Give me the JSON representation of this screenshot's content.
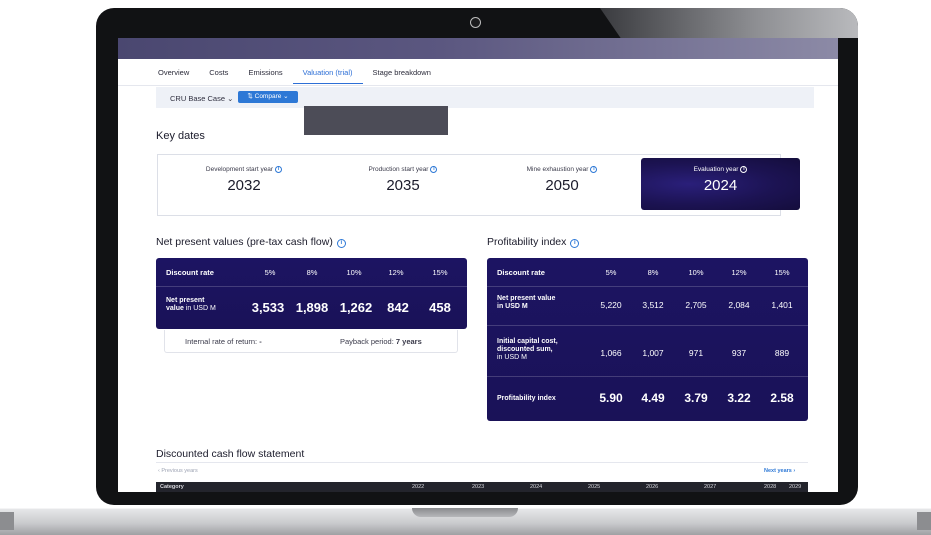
{
  "tabs": [
    {
      "label": "Overview"
    },
    {
      "label": "Costs"
    },
    {
      "label": "Emissions"
    },
    {
      "label": "Valuation (trial)",
      "active": true
    },
    {
      "label": "Stage breakdown"
    }
  ],
  "scenario": {
    "selected": "CRU Base Case",
    "compare_label": "Compare"
  },
  "key_dates": {
    "title": "Key dates",
    "items": [
      {
        "label": "Development start year",
        "value": "2032"
      },
      {
        "label": "Production start year",
        "value": "2035"
      },
      {
        "label": "Mine exhaustion year",
        "value": "2050"
      },
      {
        "label": "Evaluation year",
        "value": "2024",
        "highlighted": true
      }
    ]
  },
  "npv": {
    "title": "Net present values (pre-tax cash flow)",
    "header_label": "Discount rate",
    "rates": [
      "5%",
      "8%",
      "10%",
      "12%",
      "15%"
    ],
    "row_label": "Net present",
    "row_label_2": "value",
    "row_unit": "in USD M",
    "values": [
      "3,533",
      "1,898",
      "1,262",
      "842",
      "458"
    ],
    "irr_label": "Internal rate of return:",
    "irr_value": "-",
    "payback_label": "Payback period:",
    "payback_value": "7 years"
  },
  "profitability": {
    "title": "Profitability index",
    "header_label": "Discount rate",
    "rates": [
      "5%",
      "8%",
      "10%",
      "12%",
      "15%"
    ],
    "rows": [
      {
        "label_1": "Net present value",
        "label_2": "in USD M",
        "values": [
          "5,220",
          "3,512",
          "2,705",
          "2,084",
          "1,401"
        ]
      },
      {
        "label_1": "Initial capital cost,",
        "label_2": "discounted sum,",
        "label_3": "in USD M",
        "values": [
          "1,066",
          "1,007",
          "971",
          "937",
          "889"
        ]
      },
      {
        "label_1": "Profitability index",
        "values": [
          "5.90",
          "4.49",
          "3.79",
          "3.22",
          "2.58"
        ]
      }
    ]
  },
  "dcf": {
    "title": "Discounted cash flow statement",
    "previous_label": "Previous years",
    "next_label": "Next years",
    "category_label": "Category",
    "years": [
      "2022",
      "2023",
      "2024",
      "2025",
      "2026",
      "2027",
      "2028",
      "2029"
    ]
  },
  "colors": {
    "accent": "#2d78d6",
    "dark_card": "#1c1462"
  }
}
